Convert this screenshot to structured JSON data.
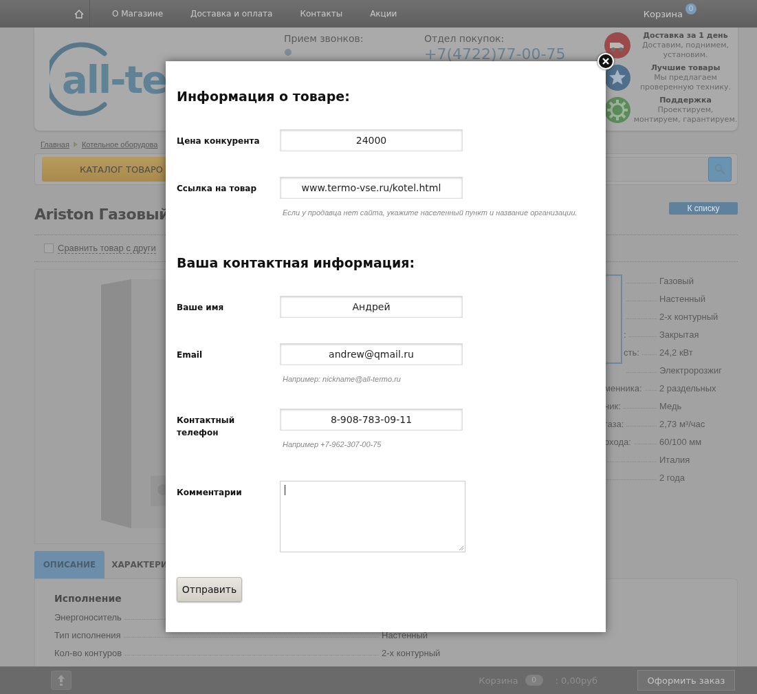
{
  "top_nav": {
    "items": [
      "О Магазине",
      "Доставка и оплата",
      "Контакты",
      "Акции"
    ],
    "cart": {
      "label": "Корзина",
      "count": "0"
    }
  },
  "header": {
    "logo": "all-te",
    "calls": {
      "label": "Прием звонков:"
    },
    "sales": {
      "label": "Отдел покупок:",
      "phone": "+7(4722)77-00-75"
    },
    "features": [
      {
        "kind": "truck",
        "title": "Доставка за 1 день",
        "text": "Доставим, поднимем, установим."
      },
      {
        "kind": "star",
        "title": "Лучшие товары",
        "text": "Мы предлагаем проверенную технику."
      },
      {
        "kind": "gear",
        "title": "Поддержка",
        "text": "Проектируем, монтируем, гарантируем."
      }
    ]
  },
  "breadcrumbs": [
    "Главная",
    "Котельное оборудова"
  ],
  "catalog_button": "КАТАЛОГ ТОВАРО",
  "product": {
    "title": "Ariston Газовый",
    "back_button": "К списку",
    "compare": {
      "label": "Сравнить товар с други",
      "checked": false
    },
    "specs": [
      {
        "value": "Газовый"
      },
      {
        "value": "Настенный"
      },
      {
        "value": "2-х контурный"
      },
      {
        "label": ":",
        "value": "Закрытая"
      },
      {
        "label": "сть:",
        "value": "24,2 кВт"
      },
      {
        "value": "Электророзжиг"
      },
      {
        "label": "менника:",
        "value": "2 раздельных"
      },
      {
        "label": "ник:",
        "value": "Медь"
      },
      {
        "label": "газа:",
        "value": "2,73 м³/час"
      },
      {
        "label": "охода:",
        "value": "60/100 мм"
      },
      {
        "value": "Италия"
      },
      {
        "value": "2 года"
      }
    ]
  },
  "tabs": [
    {
      "label": "ОПИСАНИЕ",
      "selected": true
    },
    {
      "label": "ХАРАКТЕРИ",
      "selected": false
    }
  ],
  "description": {
    "heading": "Исполнение",
    "rows": [
      {
        "label": "Энергоноситель"
      },
      {
        "label": "Тип исполнения",
        "value": "Настенный"
      },
      {
        "label": "Кол-во контуров",
        "value": "2-х контурный"
      }
    ]
  },
  "bottom_bar": {
    "cart_label": "Корзина",
    "cart_count": "0",
    "total": ": 0,00руб",
    "checkout_button": "Оформить заказ"
  },
  "modal": {
    "sections": [
      {
        "title": "Информация о товаре:",
        "fields": [
          {
            "kind": "input",
            "label": "Цена конкурента",
            "value": "24000"
          },
          {
            "kind": "input",
            "label": "Ссылка на товар",
            "value": "www.termo-vse.ru/kotel.html",
            "hint": "Если у продавца нет сайта, укажите населенный пункт и название организации."
          }
        ]
      },
      {
        "title": "Ваша контактная информация:",
        "fields": [
          {
            "kind": "input",
            "label": "Ваше имя",
            "value": "Андрей"
          },
          {
            "kind": "input",
            "label": "Email",
            "value": "andrew@qmail.ru",
            "hint": "Например: nickname@all-termo.ru"
          },
          {
            "kind": "input",
            "label": "Контактный телефон",
            "value": "8-908-783-09-11",
            "hint": "Например +7-962-307-00-75"
          },
          {
            "kind": "textarea",
            "label": "Комментарии"
          }
        ]
      }
    ],
    "submit_button": "Отправить"
  }
}
